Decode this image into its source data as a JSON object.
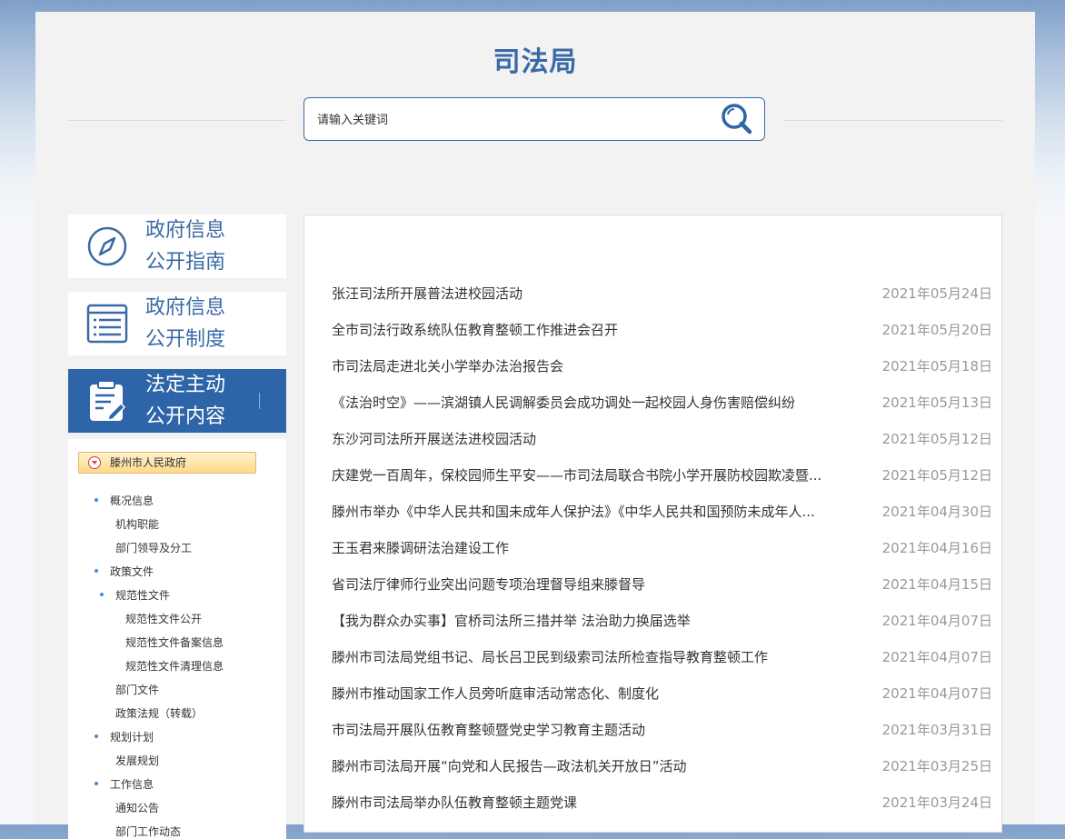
{
  "header": {
    "title": "司法局",
    "search": {
      "placeholder": "请输入关键词",
      "value": ""
    }
  },
  "nav": [
    {
      "line1": "政府信息",
      "line2": "公开指南",
      "icon": "compass-icon",
      "active": false
    },
    {
      "line1": "政府信息",
      "line2": "公开制度",
      "icon": "document-list-icon",
      "active": false
    },
    {
      "line1": "法定主动",
      "line2": "公开内容",
      "icon": "clipboard-edit-icon",
      "active": true
    }
  ],
  "tree": {
    "root": "滕州市人民政府",
    "items": [
      {
        "label": "概况信息",
        "level": 1,
        "bullet": true
      },
      {
        "label": "机构职能",
        "level": 2,
        "bullet": false
      },
      {
        "label": "部门领导及分工",
        "level": 2,
        "bullet": false
      },
      {
        "label": "政策文件",
        "level": 1,
        "bullet": true
      },
      {
        "label": "规范性文件",
        "level": 2,
        "bullet": true
      },
      {
        "label": "规范性文件公开",
        "level": 3,
        "bullet": false
      },
      {
        "label": "规范性文件备案信息",
        "level": 3,
        "bullet": false
      },
      {
        "label": "规范性文件清理信息",
        "level": 3,
        "bullet": false
      },
      {
        "label": "部门文件",
        "level": 2,
        "bullet": false
      },
      {
        "label": "政策法规（转载）",
        "level": 2,
        "bullet": false
      },
      {
        "label": "规划计划",
        "level": 1,
        "bullet": true
      },
      {
        "label": "发展规划",
        "level": 2,
        "bullet": false
      },
      {
        "label": "工作信息",
        "level": 1,
        "bullet": true
      },
      {
        "label": "通知公告",
        "level": 2,
        "bullet": false
      },
      {
        "label": "部门工作动态",
        "level": 2,
        "bullet": false
      }
    ]
  },
  "news": [
    {
      "title": "张汪司法所开展普法进校园活动",
      "date": "2021年05月24日"
    },
    {
      "title": "全市司法行政系统队伍教育整顿工作推进会召开",
      "date": "2021年05月20日"
    },
    {
      "title": "市司法局走进北关小学举办法治报告会",
      "date": "2021年05月18日"
    },
    {
      "title": "《法治时空》——滨湖镇人民调解委员会成功调处一起校园人身伤害赔偿纠纷",
      "date": "2021年05月13日"
    },
    {
      "title": "东沙河司法所开展送法进校园活动",
      "date": "2021年05月12日"
    },
    {
      "title": "庆建党一百周年，保校园师生平安——市司法局联合书院小学开展防校园欺凌暨...",
      "date": "2021年05月12日"
    },
    {
      "title": "滕州市举办《中华人民共和国未成年人保护法》《中华人民共和国预防未成年人...",
      "date": "2021年04月30日"
    },
    {
      "title": "王玉君来滕调研法治建设工作",
      "date": "2021年04月16日"
    },
    {
      "title": "省司法厅律师行业突出问题专项治理督导组来滕督导",
      "date": "2021年04月15日"
    },
    {
      "title": "【我为群众办实事】官桥司法所三措并举 法治助力换届选举",
      "date": "2021年04月07日"
    },
    {
      "title": "滕州市司法局党组书记、局长吕卫民到级索司法所检查指导教育整顿工作",
      "date": "2021年04月07日"
    },
    {
      "title": "滕州市推动国家工作人员旁听庭审活动常态化、制度化",
      "date": "2021年04月07日"
    },
    {
      "title": "市司法局开展队伍教育整顿暨党史学习教育主题活动",
      "date": "2021年03月31日"
    },
    {
      "title": "滕州市司法局开展“向党和人民报告—政法机关开放日”活动",
      "date": "2021年03月25日"
    },
    {
      "title": "滕州市司法局举办队伍教育整顿主题党课",
      "date": "2021年03月24日"
    }
  ],
  "colors": {
    "brand": "#3a6aa6",
    "active_nav": "#2e65a8",
    "date": "#999999"
  }
}
